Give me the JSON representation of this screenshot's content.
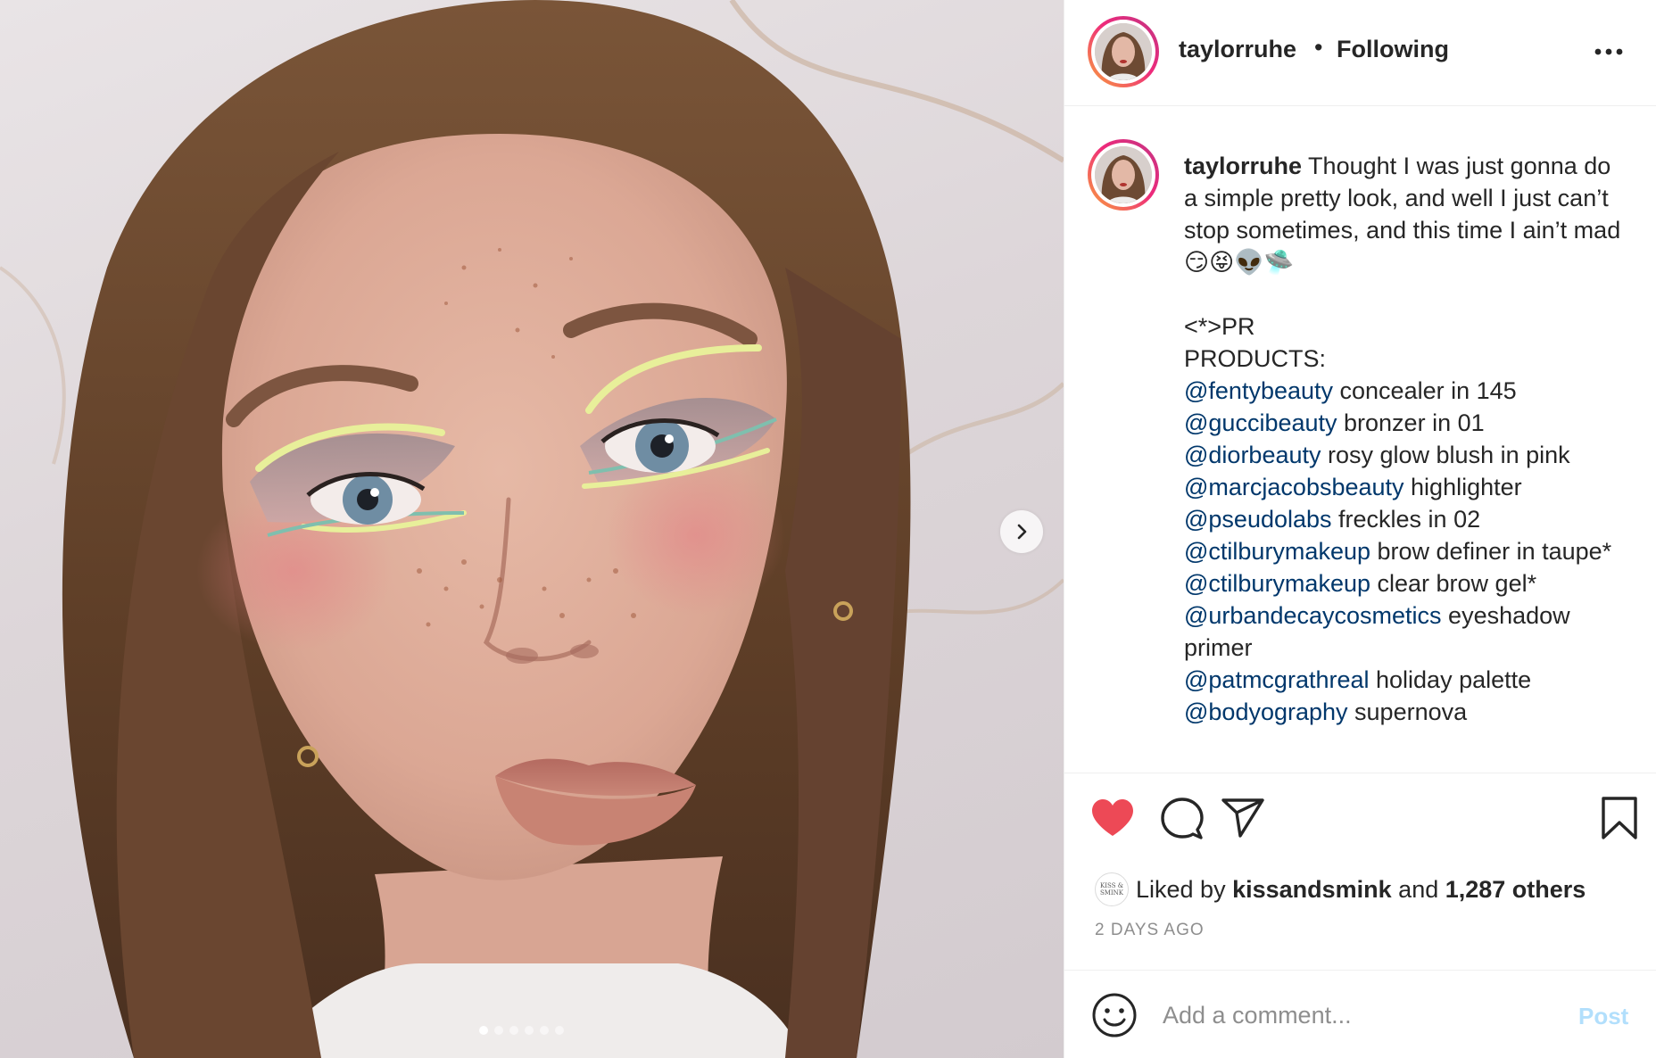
{
  "post": {
    "username": "taylorruhe",
    "separator": "•",
    "follow_status": "Following",
    "more_icon": "more-horizontal-icon"
  },
  "caption": {
    "username": "taylorruhe",
    "text_lines": [
      " Thought I was just gonna do a simple pretty look, and well I just can’t stop sometimes, and this time I ain’t mad😏😝👽🛸",
      "",
      "<*>PR",
      "PRODUCTS:"
    ],
    "products": [
      {
        "mention": "@fentybeauty",
        "text": " concealer in 145"
      },
      {
        "mention": "@guccibeauty",
        "text": " bronzer in 01"
      },
      {
        "mention": "@diorbeauty",
        "text": " rosy glow blush in pink"
      },
      {
        "mention": "@marcjacobsbeauty",
        "text": " highlighter"
      },
      {
        "mention": "@pseudolabs",
        "text": " freckles in 02"
      },
      {
        "mention": "@ctilburymakeup",
        "text": " brow definer in taupe*"
      },
      {
        "mention": "@ctilburymakeup",
        "text": " clear brow gel*"
      },
      {
        "mention": "@urbandecaycosmetics",
        "text": " eyeshadow primer"
      },
      {
        "mention": "@patmcgrathreal",
        "text": " holiday palette"
      },
      {
        "mention": "@bodyography",
        "text": " supernova"
      }
    ]
  },
  "likes": {
    "prefix": "Liked by ",
    "liker": "kissandsmink",
    "middle": " and ",
    "count": "1,287 others",
    "liker_avatar_text": "KISS & SMINK"
  },
  "timestamp": "2 DAYS AGO",
  "comment_box": {
    "placeholder": "Add a comment...",
    "post_label": "Post"
  },
  "carousel": {
    "total_slides": 6,
    "active_index": 0
  },
  "colors": {
    "heart": "#ed4956",
    "mention": "#00376b",
    "post_disabled": "#b2dffc",
    "secondary_text": "#8e8e8e"
  },
  "icons": {
    "like": "heart-filled-icon",
    "comment": "comment-bubble-icon",
    "share": "paper-plane-icon",
    "save": "bookmark-icon",
    "emoji": "smiley-icon",
    "next": "chevron-right-icon"
  }
}
